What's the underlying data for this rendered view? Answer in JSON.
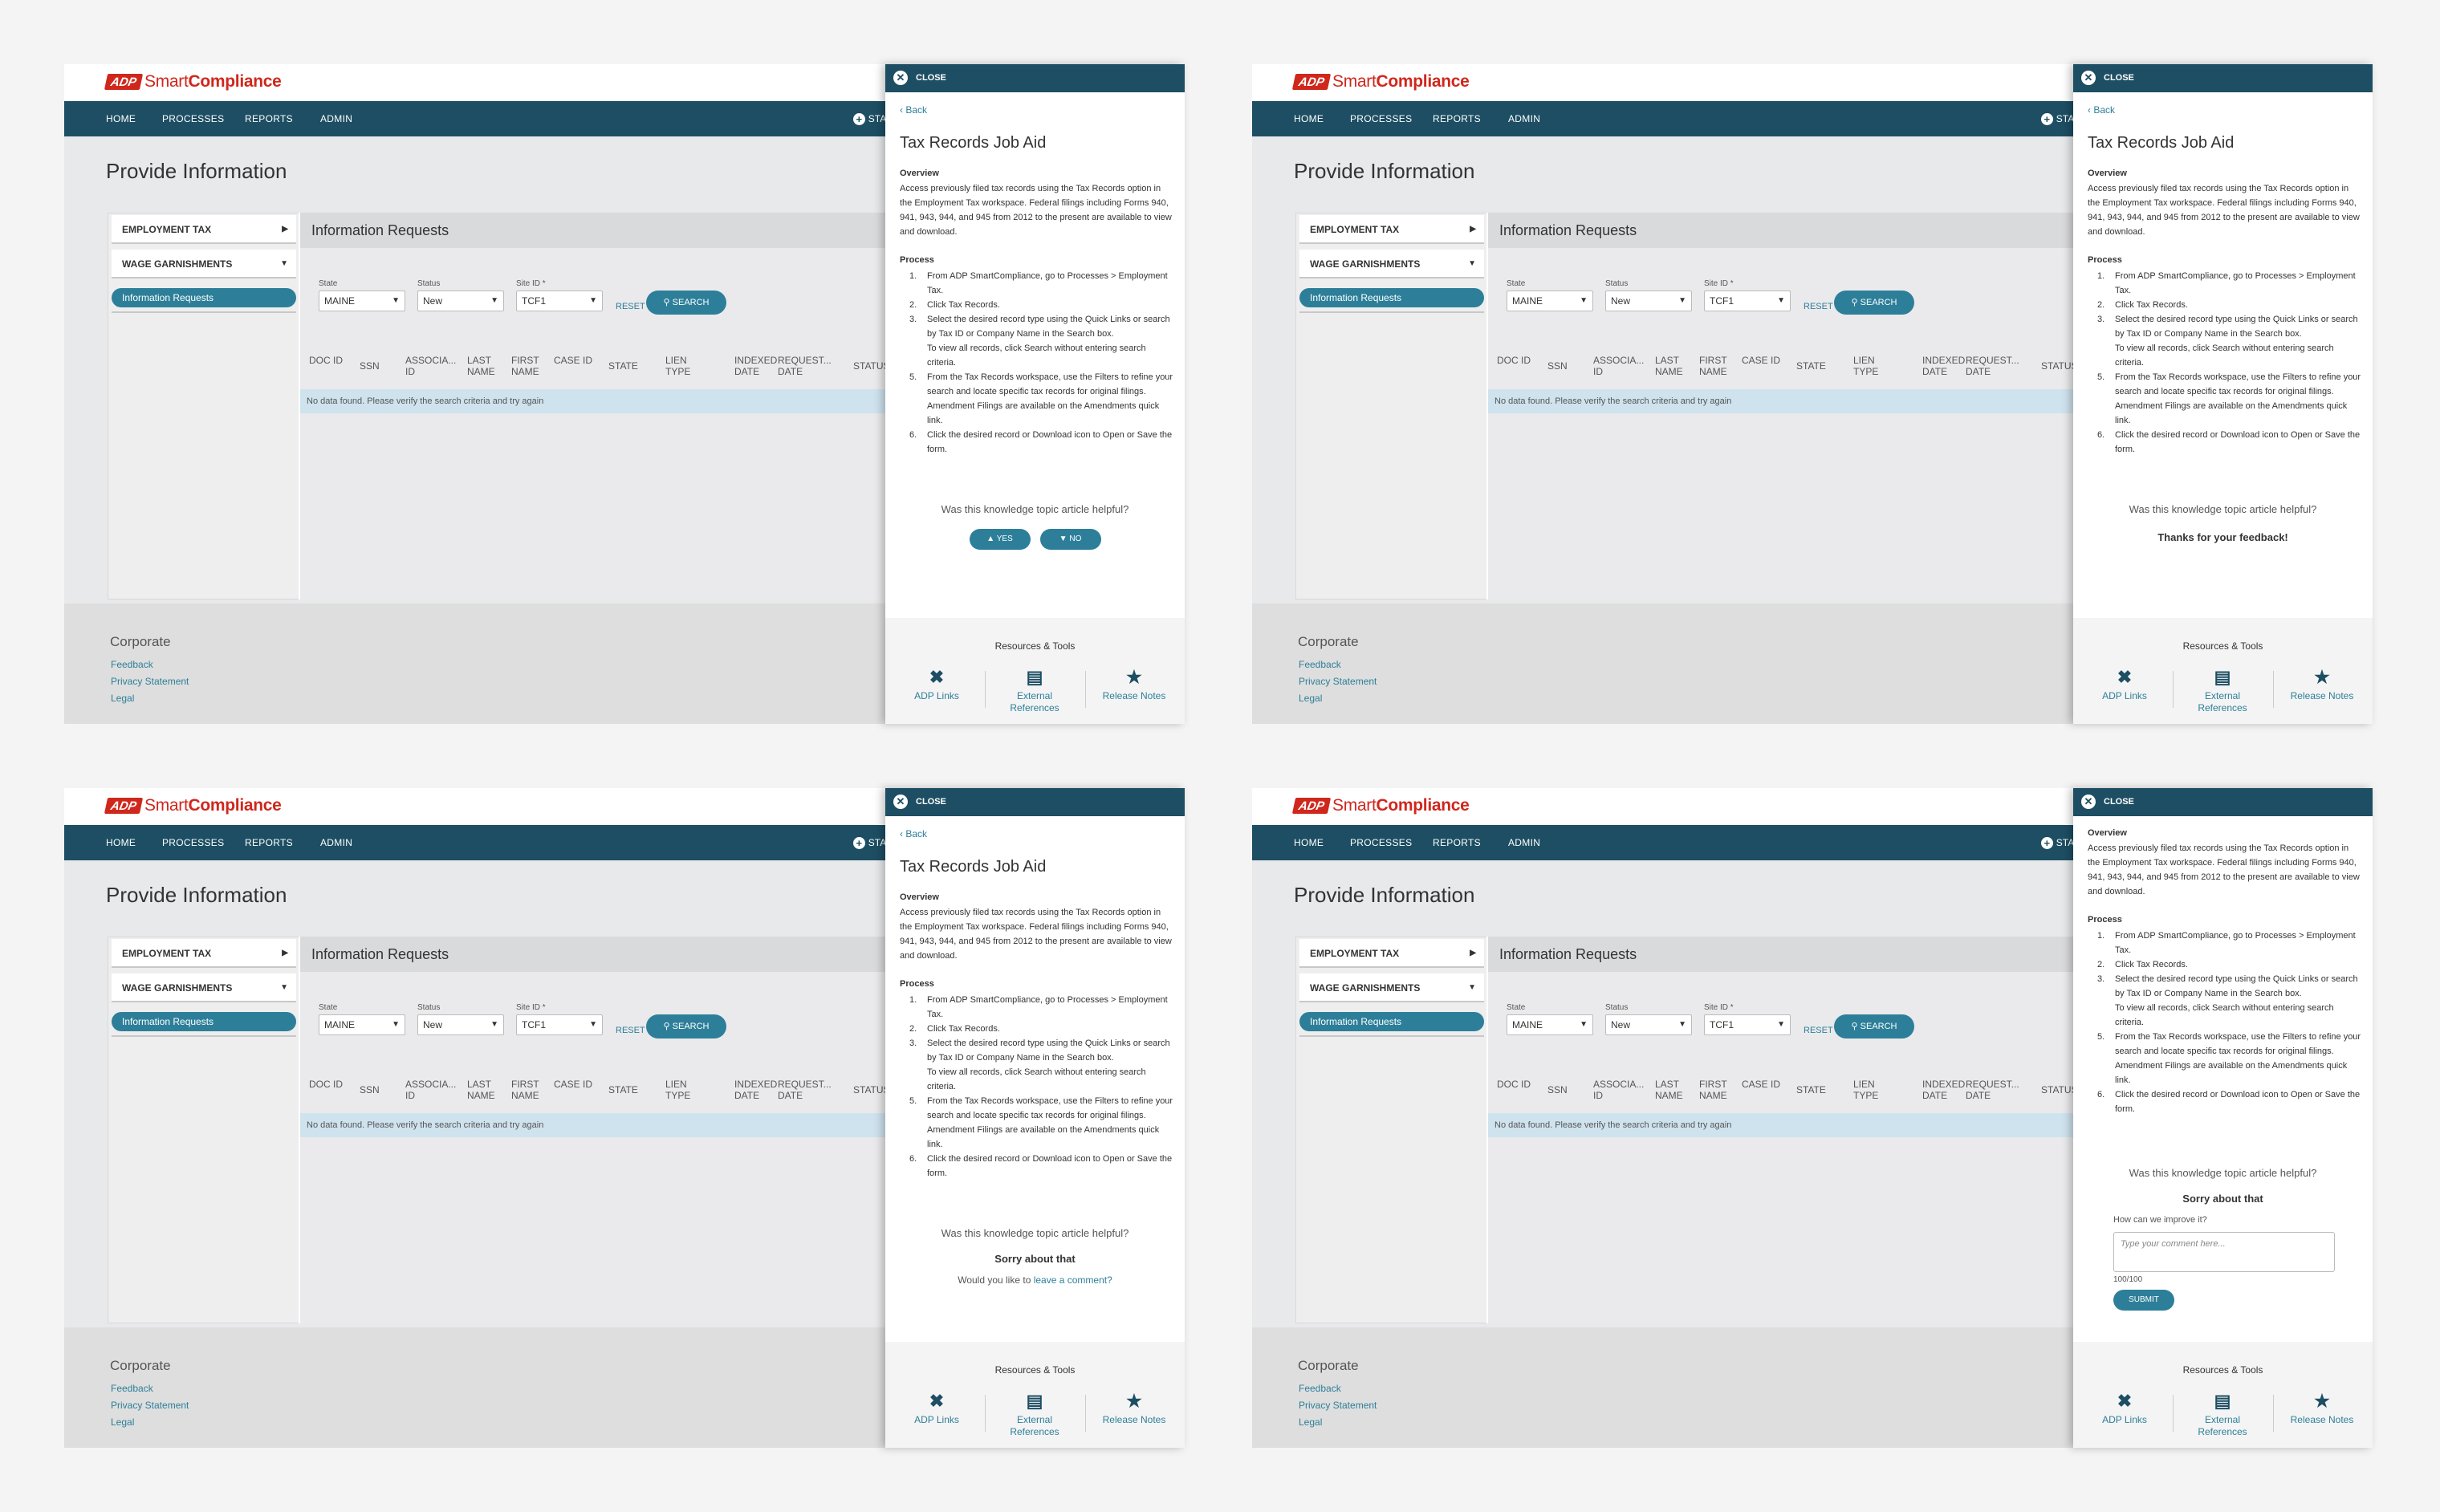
{
  "brand": {
    "logo_mark": "ADP",
    "logo_light": "Smart",
    "logo_bold": "Compliance"
  },
  "nav": {
    "home": "HOME",
    "processes": "PROCESSES",
    "reports": "REPORTS",
    "admin": "ADMIN",
    "start": "START"
  },
  "page_title": "Provide Information",
  "sidebar": {
    "employment_tax": "EMPLOYMENT TAX",
    "wage_garnishments": "WAGE GARNISHMENTS",
    "info_requests": "Information Requests"
  },
  "panel": {
    "title": "Information Requests",
    "state_label": "State",
    "state_value": "MAINE",
    "status_label": "Status",
    "status_value": "New",
    "site_label": "Site ID *",
    "site_value": "TCF1",
    "reset": "RESET",
    "search": "SEARCH",
    "columns": [
      "DOC ID",
      "SSN",
      "ASSOCIA... ID",
      "LAST NAME",
      "FIRST NAME",
      "CASE ID",
      "STATE",
      "LIEN TYPE",
      "INDEXED DATE",
      "REQUEST... DATE",
      "STATUS"
    ],
    "no_data": "No data found. Please verify the search criteria and try again"
  },
  "footer": {
    "corporate": "Corporate",
    "feedback": "Feedback",
    "privacy": "Privacy Statement",
    "legal": "Legal"
  },
  "drawer": {
    "close": "CLOSE",
    "back": "Back",
    "title": "Tax Records Job Aid",
    "overview_h": "Overview",
    "overview": "Access previously filed tax records using the Tax Records option in the Employment Tax workspace.  Federal filings including Forms 940, 941, 943, 944, and 945 from 2012 to the present are available to view and download.",
    "process_h": "Process",
    "step1": "From ADP SmartCompliance, go to Processes > Employment Tax.",
    "step2": "Click Tax Records.",
    "step3": "Select the desired record type using the Quick Links or search by Tax ID or Company Name in the Search box.",
    "step3b": "To view all records, click Search without entering search criteria.",
    "step5": "From the Tax Records workspace, use the Filters to refine your search and locate specific tax records for original filings. Amendment Filings are available on the Amendments quick link.",
    "step6": "Click the desired record or Download icon to Open or Save the form.",
    "helpful": "Was this knowledge topic article helpful?",
    "yes": "YES",
    "no": "NO",
    "thanks": "Thanks for your feedback!",
    "sorry": "Sorry about that",
    "comment_q": "Would you like to",
    "comment_link": "leave a comment?",
    "improve": "How can we improve it?",
    "placeholder": "Type your comment here...",
    "counter": "100/100",
    "submit": "SUBMIT",
    "resources": "Resources & Tools",
    "tool_links": "ADP Links",
    "tool_ext": "External References",
    "tool_notes": "Release Notes"
  },
  "colors": {
    "navbar": "#1d4e63",
    "accent": "#2d7f99",
    "brand_red": "#d0271d",
    "no_data_bg": "#cfe3ee"
  },
  "icons": {
    "close": "close-icon",
    "back": "chevron-left-icon",
    "search": "search-icon",
    "thumbs_up": "thumbs-up-icon",
    "thumbs_down": "thumbs-down-icon",
    "tools": "wrench-screwdriver-icon",
    "external": "bank-building-icon",
    "notes": "star-icon"
  }
}
